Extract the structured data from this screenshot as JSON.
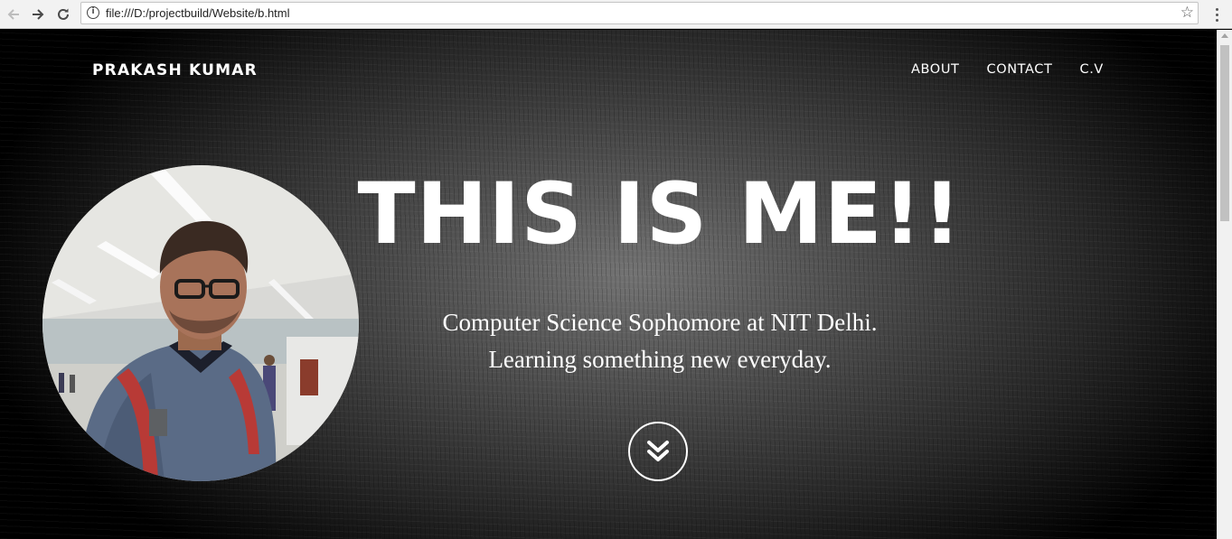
{
  "browser": {
    "url": "file:///D:/projectbuild/Website/b.html",
    "back_icon": "arrow-left-icon",
    "forward_icon": "arrow-right-icon",
    "reload_icon": "reload-icon",
    "info_icon": "info-icon",
    "bookmark_icon": "star-icon",
    "menu_icon": "kebab-menu-icon"
  },
  "site": {
    "brand": "PRAKASH KUMAR",
    "nav": [
      "ABOUT",
      "CONTACT",
      "C.V"
    ],
    "headline": "THIS IS ME!!",
    "subtitle_line1": "Computer Science Sophomore at NIT Delhi.",
    "subtitle_line2": "Learning something new everyday.",
    "scroll_icon": "double-chevron-down-icon",
    "text_color": "#ffffff"
  }
}
